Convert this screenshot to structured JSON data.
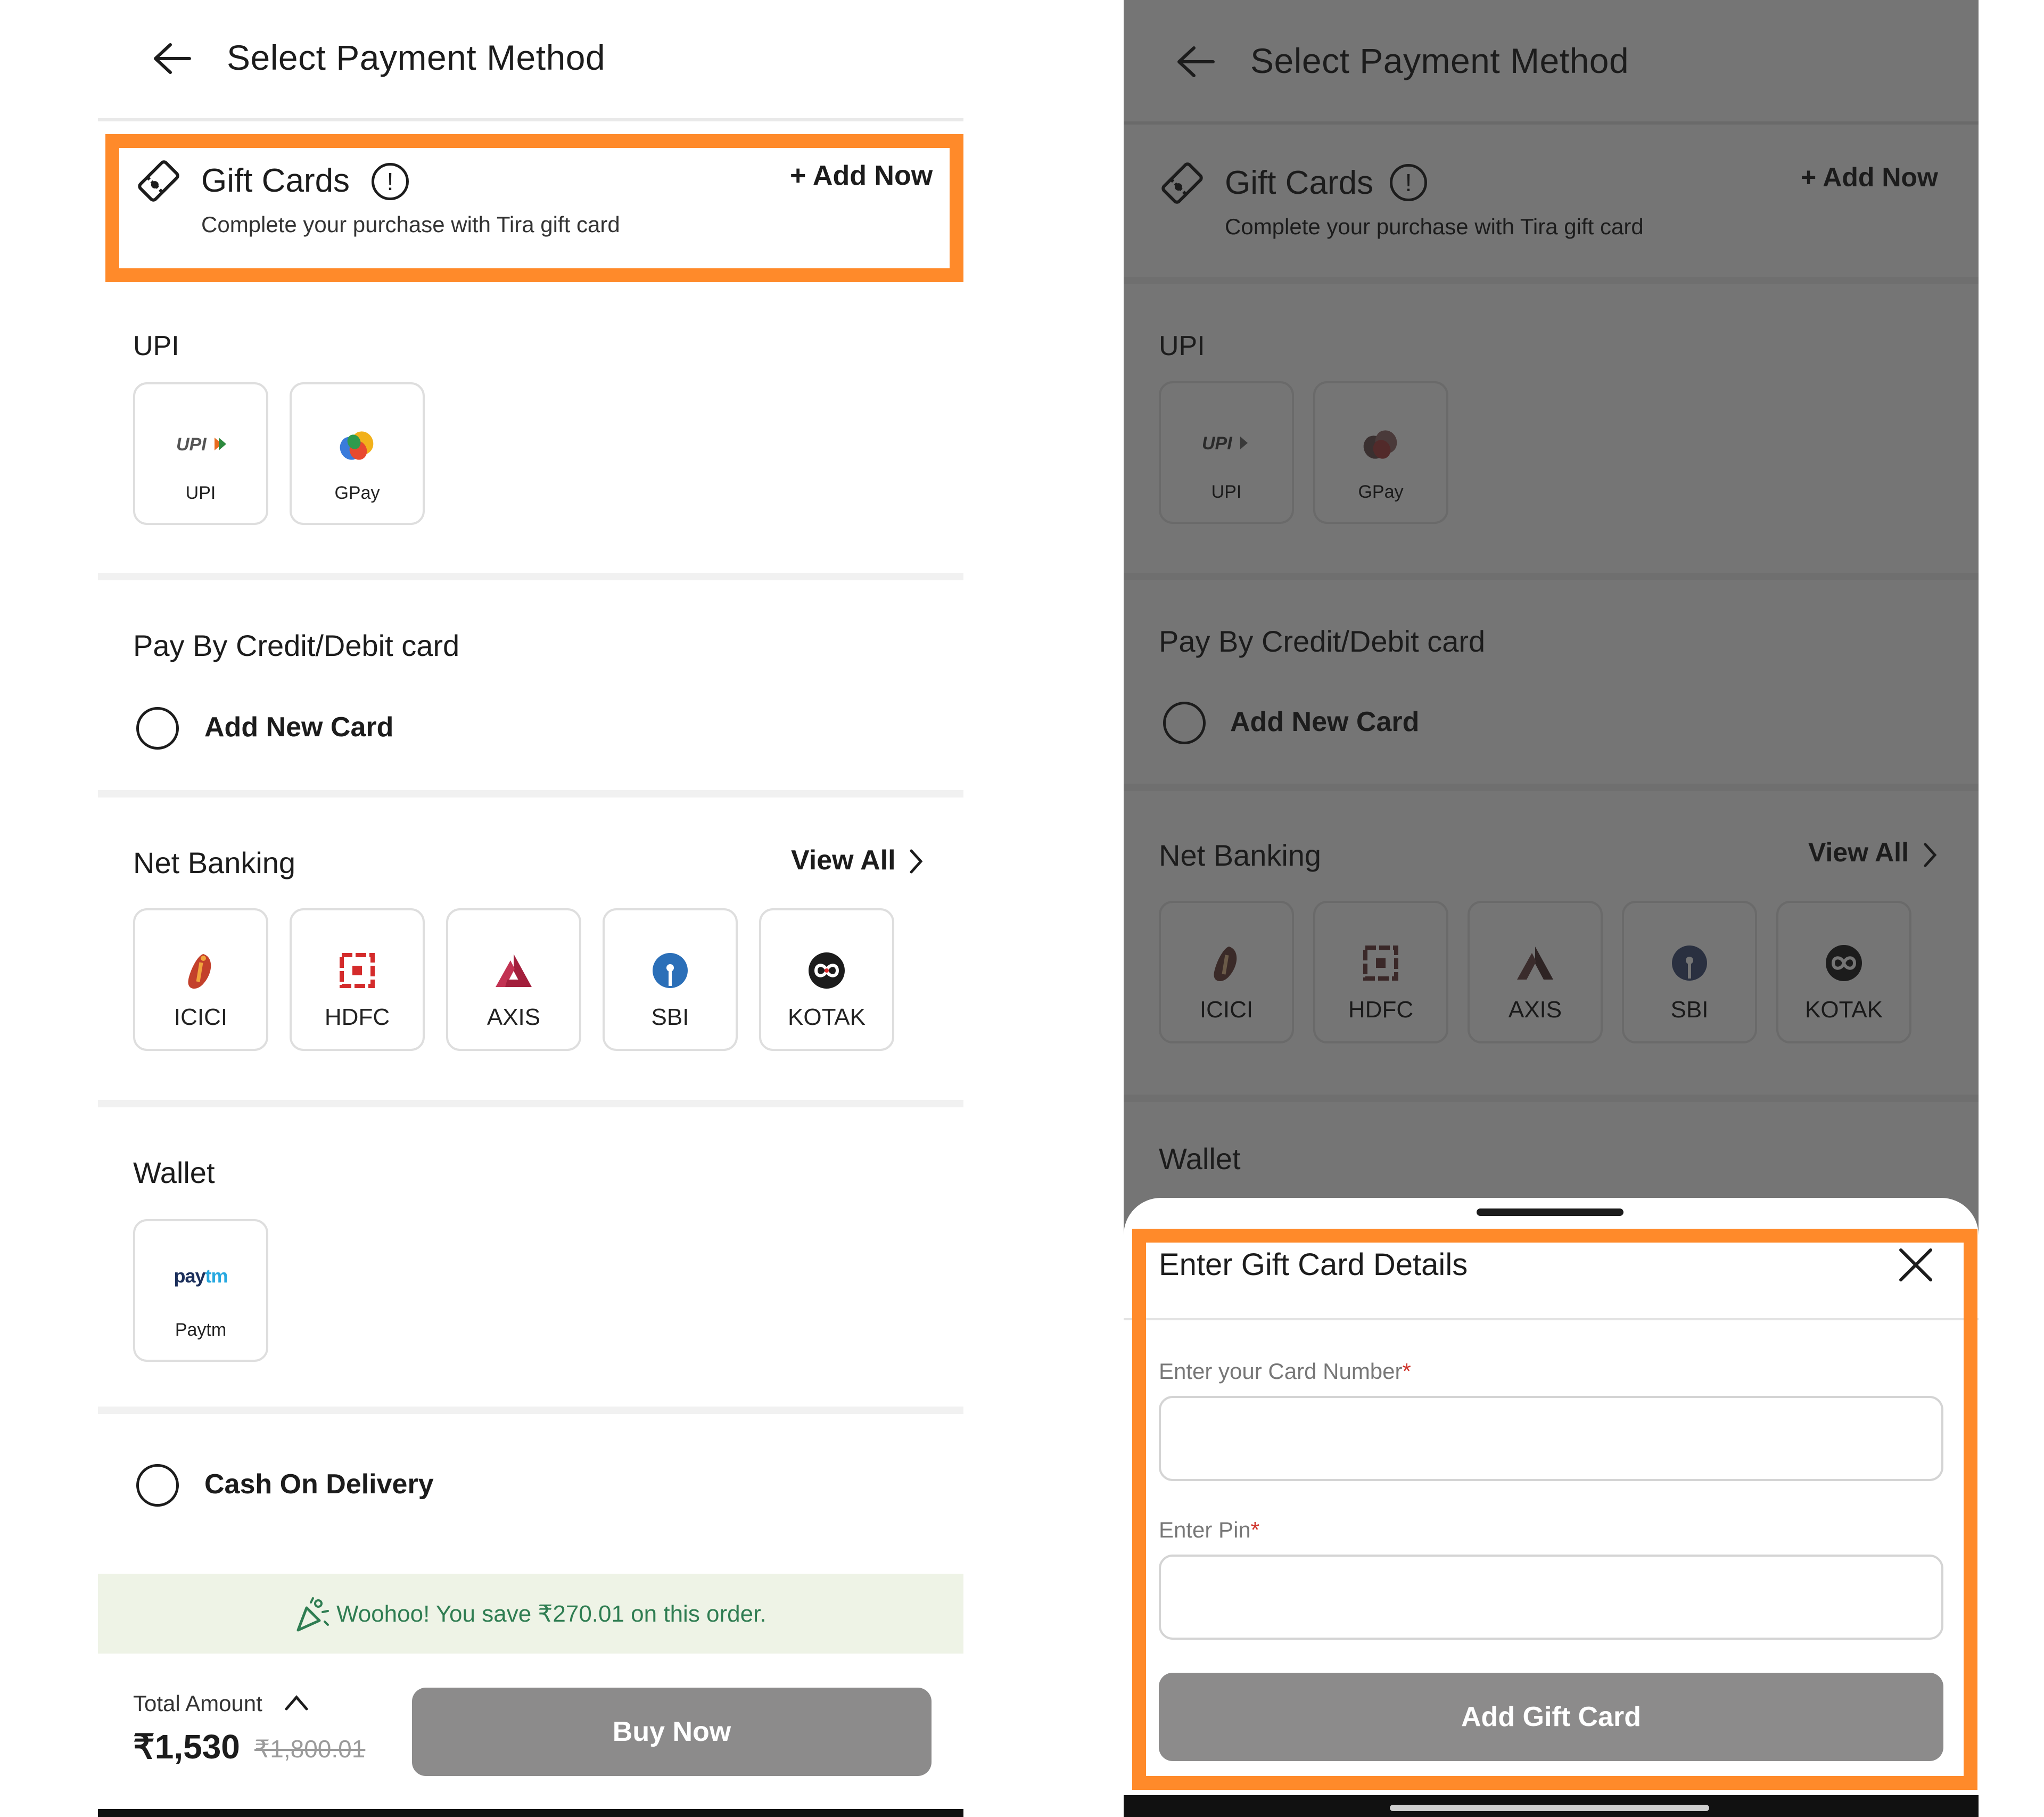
{
  "left": {
    "header": {
      "title": "Select Payment Method"
    },
    "gift_cards": {
      "title": "Gift Cards",
      "subtitle": "Complete your purchase with Tira gift card",
      "add_label": "+ Add Now"
    },
    "upi": {
      "title": "UPI",
      "options": [
        {
          "label": "UPI"
        },
        {
          "label": "GPay"
        }
      ]
    },
    "cards": {
      "title": "Pay By Credit/Debit card",
      "add_new": "Add New Card"
    },
    "net_banking": {
      "title": "Net Banking",
      "view_all": "View All",
      "banks": [
        {
          "label": "ICICI",
          "icon": "icici-icon"
        },
        {
          "label": "HDFC",
          "icon": "hdfc-icon"
        },
        {
          "label": "AXIS",
          "icon": "axis-icon"
        },
        {
          "label": "SBI",
          "icon": "sbi-icon"
        },
        {
          "label": "KOTAK",
          "icon": "kotak-icon"
        }
      ]
    },
    "wallet": {
      "title": "Wallet",
      "options": [
        {
          "label": "Paytm",
          "logo": "paytm"
        }
      ]
    },
    "cod": {
      "label": "Cash On Delivery"
    },
    "savings_banner": "Woohoo! You save ₹270.01 on this order.",
    "footer": {
      "total_label": "Total Amount",
      "price": "₹1,530",
      "original_price": "₹1,800.01",
      "buy_label": "Buy Now"
    }
  },
  "right": {
    "header": {
      "title": "Select Payment Method"
    },
    "gift_cards": {
      "title": "Gift Cards",
      "subtitle": "Complete your purchase with Tira gift card",
      "add_label": "+ Add Now"
    },
    "upi": {
      "title": "UPI",
      "options": [
        {
          "label": "UPI"
        },
        {
          "label": "GPay"
        }
      ]
    },
    "cards": {
      "title": "Pay By Credit/Debit card",
      "add_new": "Add New Card"
    },
    "net_banking": {
      "title": "Net Banking",
      "view_all": "View All",
      "banks": [
        {
          "label": "ICICI"
        },
        {
          "label": "HDFC"
        },
        {
          "label": "AXIS"
        },
        {
          "label": "SBI"
        },
        {
          "label": "KOTAK"
        }
      ]
    },
    "wallet": {
      "title": "Wallet"
    },
    "sheet": {
      "title": "Enter Gift Card Details",
      "card_number_label": "Enter your Card Number",
      "pin_label": "Enter Pin",
      "required_mark": "*",
      "add_button": "Add Gift Card"
    }
  },
  "colors": {
    "highlight": "#ff8a2a",
    "banner_bg": "#eef3e6",
    "banner_text": "#2f7d52",
    "button_grey": "#8c8b8b",
    "required": "#d0342c"
  }
}
